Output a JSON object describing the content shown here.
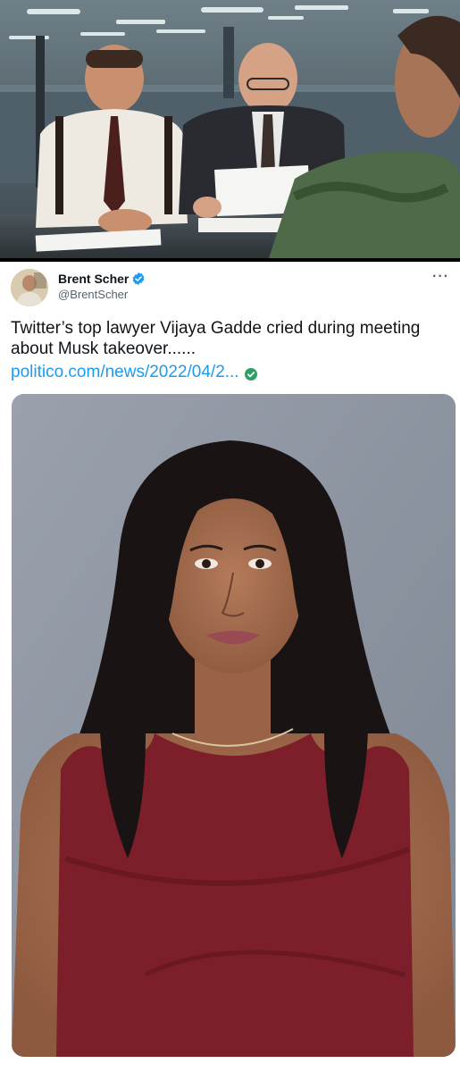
{
  "tweet": {
    "author_name": "Brent Scher",
    "author_handle": "@BrentScher",
    "text": "Twitter’s top lawyer Vijaya Gadde cried during meeting about Musk takeover......",
    "link_text": "politico.com/news/2022/04/2...",
    "more_icon": "more-options-icon",
    "verified_icon": "verified-badge-icon"
  },
  "colors": {
    "link": "#1d9bf0",
    "verified": "#1d9bf0",
    "text_primary": "#0f1419",
    "text_secondary": "#536471"
  }
}
